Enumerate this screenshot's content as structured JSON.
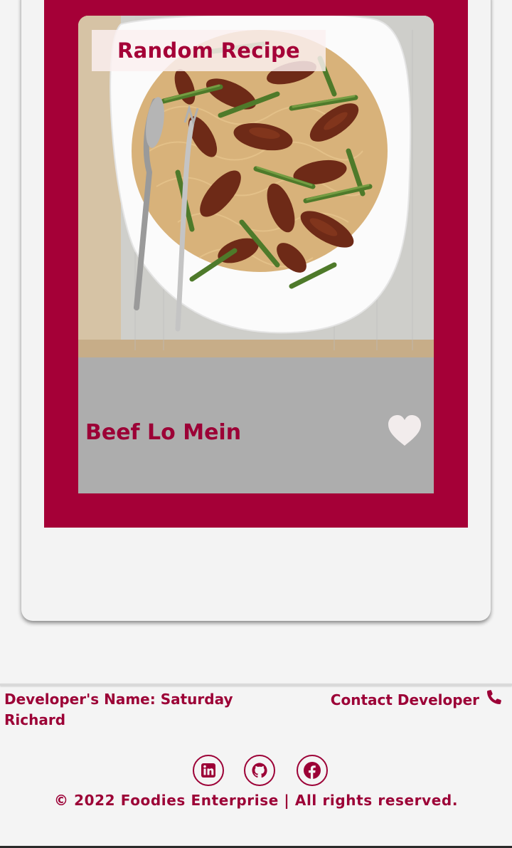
{
  "recipe_card": {
    "badge_label": "Random Recipe",
    "recipe_name": "Beef Lo Mein",
    "favorite_icon": "heart-icon",
    "image_alt": "Beef lo mein with asparagus on a white platter"
  },
  "footer": {
    "developer_name": "Developer's Name: Saturday Richard",
    "contact_label": "Contact Developer",
    "contact_icon": "phone-icon",
    "social_icons": [
      "linkedin-icon",
      "github-icon",
      "facebook-icon"
    ],
    "copyright": "© 2022 Foodies Enterprise | All rights reserved."
  },
  "colors": {
    "brand": "#a50037",
    "text": "#9c0036",
    "card_caption": "#adadad",
    "page": "#f4f4f4"
  }
}
